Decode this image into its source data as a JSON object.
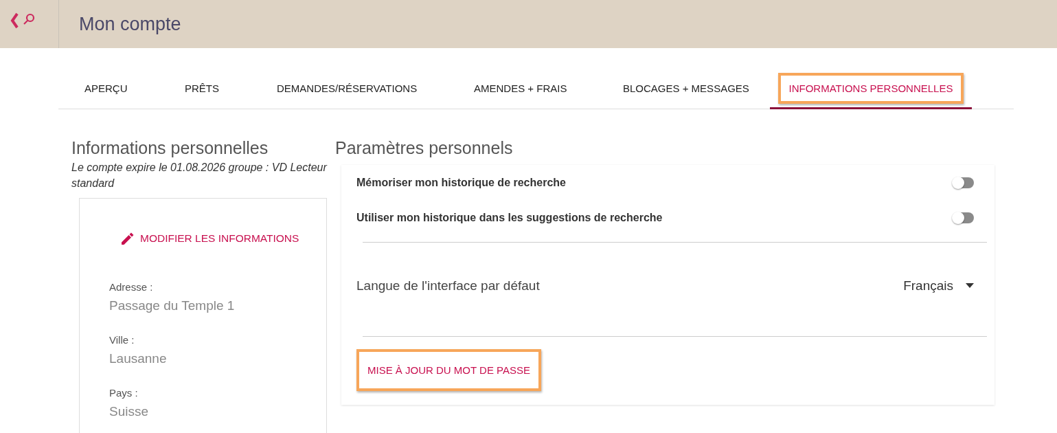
{
  "header": {
    "title": "Mon compte"
  },
  "tabs": [
    {
      "label": "APERÇU",
      "selected": false,
      "highlighted": false
    },
    {
      "label": "PRÊTS",
      "selected": false,
      "highlighted": false
    },
    {
      "label": "DEMANDES/RÉSERVATIONS",
      "selected": false,
      "highlighted": false
    },
    {
      "label": "AMENDES + FRAIS",
      "selected": false,
      "highlighted": false
    },
    {
      "label": "BLOCAGES + MESSAGES",
      "selected": false,
      "highlighted": false
    },
    {
      "label": "INFORMATIONS PERSONNELLES",
      "selected": true,
      "highlighted": true
    }
  ],
  "personal_info": {
    "heading": "Informations personnelles",
    "subtitle": "Le compte expire le 01.08.2026 groupe : VD Lecteur standard",
    "edit_button": "MODIFIER LES INFORMATIONS",
    "fields": [
      {
        "label": "Adresse :",
        "value": "Passage du Temple 1"
      },
      {
        "label": "Ville :",
        "value": "Lausanne"
      },
      {
        "label": "Pays :",
        "value": "Suisse"
      }
    ]
  },
  "settings": {
    "heading": "Paramètres personnels",
    "toggles": [
      {
        "label": "Mémoriser mon historique de recherche",
        "on": false
      },
      {
        "label": "Utiliser mon historique dans les suggestions de recherche",
        "on": false
      }
    ],
    "language": {
      "label": "Langue de l'interface par défaut",
      "value": "Français"
    },
    "password_button": {
      "label": "MISE À JOUR DU MOT DE PASSE",
      "highlighted": true
    }
  }
}
